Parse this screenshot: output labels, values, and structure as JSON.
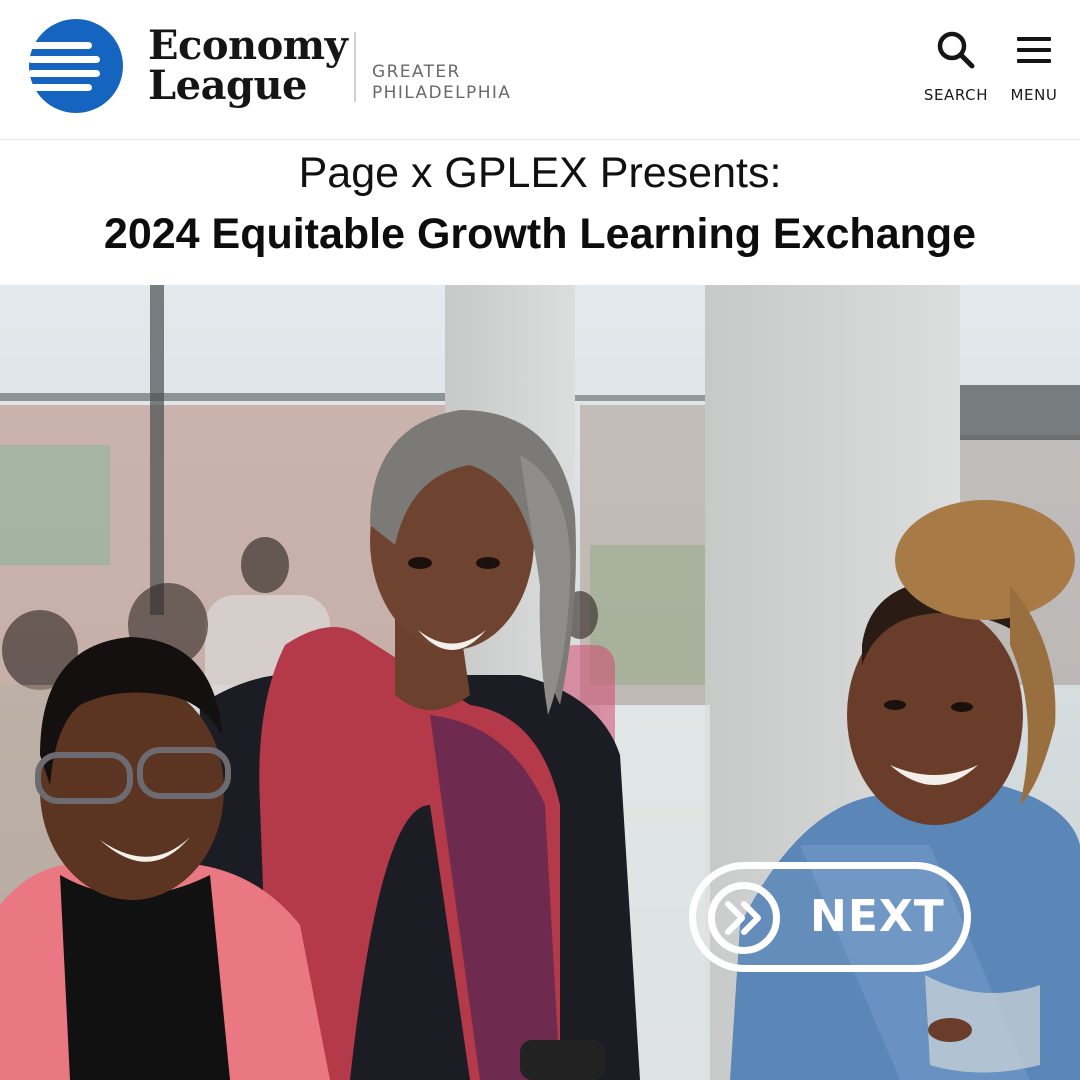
{
  "header": {
    "logo_line1": "Economy",
    "logo_line2": "League",
    "logo_sub1": "GREATER",
    "logo_sub2": "PHILADELPHIA",
    "search_label": "SEARCH",
    "menu_label": "MENU",
    "brand_color": "#1565c0"
  },
  "hero": {
    "title_line1": "Page x GPLEX Presents:",
    "title_line2": "2024 Equitable Growth Learning Exchange"
  },
  "photo": {
    "alt": "Three smiling women at an event"
  },
  "next_button": {
    "label": "NEXT",
    "icon": "double-chevron-right-icon"
  }
}
